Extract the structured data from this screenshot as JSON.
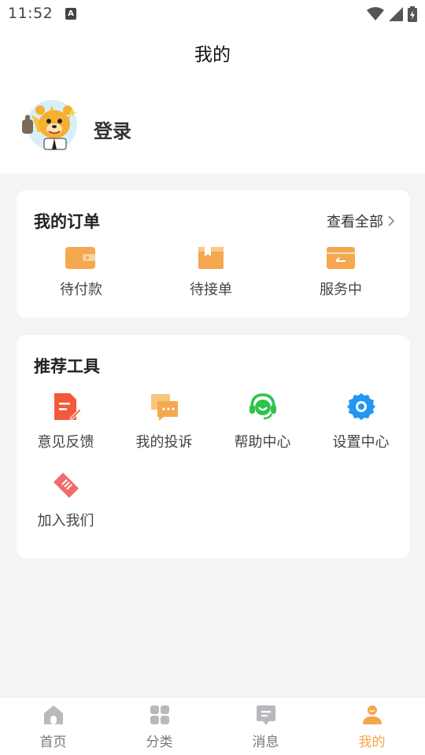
{
  "status_bar": {
    "time": "11:52",
    "notification_badge": "A"
  },
  "header": {
    "title": "我的"
  },
  "profile": {
    "login_label": "登录"
  },
  "orders": {
    "title": "我的订单",
    "view_all": "查看全部",
    "items": [
      {
        "label": "待付款",
        "icon": "wallet-icon"
      },
      {
        "label": "待接单",
        "icon": "box-icon"
      },
      {
        "label": "服务中",
        "icon": "package-icon"
      }
    ]
  },
  "tools": {
    "title": "推荐工具",
    "items": [
      {
        "label": "意见反馈",
        "icon": "feedback-icon"
      },
      {
        "label": "我的投诉",
        "icon": "complaint-icon"
      },
      {
        "label": "帮助中心",
        "icon": "headset-icon"
      },
      {
        "label": "设置中心",
        "icon": "gear-icon"
      },
      {
        "label": "加入我们",
        "icon": "handshake-icon"
      }
    ]
  },
  "tabbar": {
    "items": [
      {
        "label": "首页",
        "icon": "home-icon"
      },
      {
        "label": "分类",
        "icon": "category-icon"
      },
      {
        "label": "消息",
        "icon": "message-icon"
      },
      {
        "label": "我的",
        "icon": "user-icon"
      }
    ],
    "active_index": 3
  },
  "colors": {
    "accent": "#f5a54a",
    "background": "#f4f4f6"
  }
}
